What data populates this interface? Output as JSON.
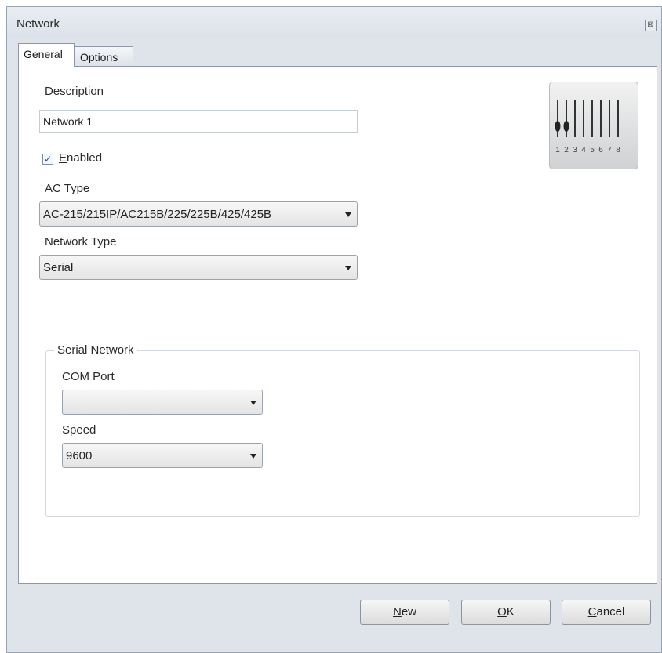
{
  "window": {
    "title": "Network",
    "close_glyph": "⊠"
  },
  "tabs": [
    {
      "label": "General",
      "active": true
    },
    {
      "label": "Options",
      "active": false
    }
  ],
  "general": {
    "description_label": "Description",
    "description_value": "Network 1",
    "enabled_label_mnemonic": "E",
    "enabled_label_rest": "nabled",
    "enabled_checked": true,
    "check_glyph": "✓",
    "ac_type_label": "AC Type",
    "ac_type_value": "AC-215/215IP/AC215B/225/225B/425/425B",
    "network_type_label": "Network Type",
    "network_type_value": "Serial"
  },
  "serial_network": {
    "group_title": "Serial Network",
    "com_port_label": "COM Port",
    "com_port_value": "",
    "speed_label": "Speed",
    "speed_value": "9600"
  },
  "device_icon": {
    "name": "dip-switch-icon",
    "numbers": [
      "1",
      "2",
      "3",
      "4",
      "5",
      "6",
      "7",
      "8"
    ]
  },
  "buttons": {
    "new": {
      "mnemonic": "N",
      "rest": "ew"
    },
    "ok": {
      "mnemonic": "O",
      "rest": "K"
    },
    "cancel": {
      "mnemonic": "C",
      "rest": "ancel"
    }
  }
}
